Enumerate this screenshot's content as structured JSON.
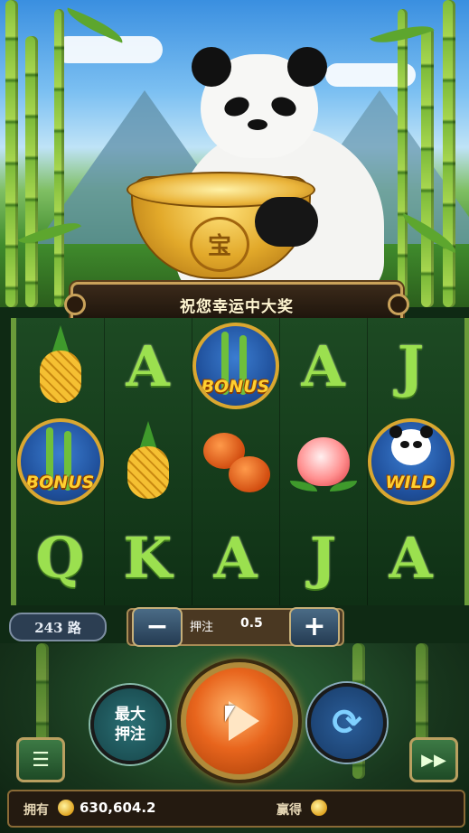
{
  "banner": {
    "text": "祝您幸运中大奖"
  },
  "bowl": {
    "mark": "宝"
  },
  "reels": {
    "columns": [
      [
        "pineapple",
        "bonus",
        "Q"
      ],
      [
        "A",
        "pineapple",
        "K"
      ],
      [
        "bonus",
        "persimmon",
        "A"
      ],
      [
        "A",
        "peach",
        "J"
      ],
      [
        "J",
        "wild",
        "A"
      ]
    ],
    "bonus_label": "BONUS",
    "wild_label": "WILD"
  },
  "ways": {
    "text": "243 路"
  },
  "bet": {
    "minus": "−",
    "plus": "+",
    "label": "押注",
    "value": "0.5"
  },
  "controls": {
    "max_bet_line1": "最大",
    "max_bet_line2": "押注",
    "menu_icon": "menu-icon",
    "fast_icon": "fast-forward-icon",
    "spin_icon": "play-icon",
    "auto_icon": "refresh-icon"
  },
  "status": {
    "balance_label": "拥有",
    "balance_value": "630,604.2",
    "win_label": "赢得",
    "win_value": ""
  },
  "colors": {
    "accent_gold": "#c9a25a",
    "spin_orange": "#e8651d",
    "letter_green": "#9be04f"
  }
}
